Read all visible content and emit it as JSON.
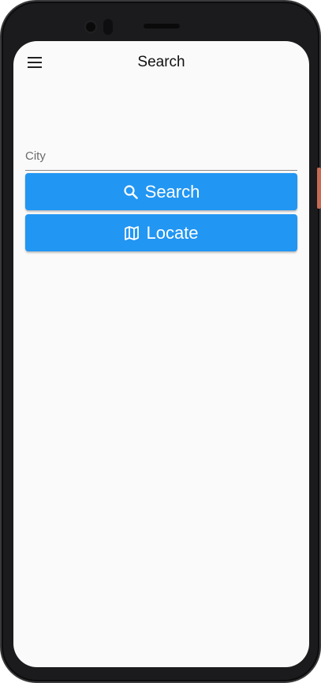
{
  "appbar": {
    "title": "Search",
    "menu_icon": "menu-icon"
  },
  "city_field": {
    "placeholder": "City",
    "value": ""
  },
  "buttons": {
    "search_label": "Search",
    "search_icon": "search-icon",
    "locate_label": "Locate",
    "locate_icon": "map-icon"
  },
  "colors": {
    "primary": "#2196f3",
    "background": "#fafafa"
  }
}
